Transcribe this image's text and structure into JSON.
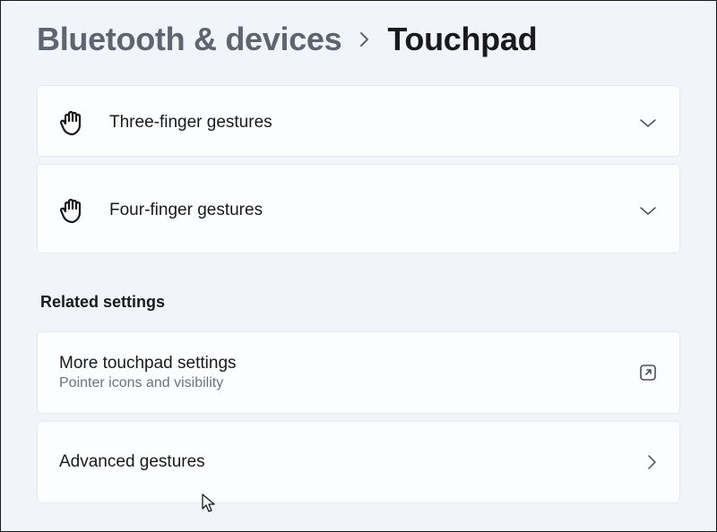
{
  "breadcrumb": {
    "parent": "Bluetooth & devices",
    "current": "Touchpad"
  },
  "gestures": {
    "three_label": "Three-finger gestures",
    "four_label": "Four-finger gestures"
  },
  "related": {
    "section_title": "Related settings",
    "more": {
      "title": "More touchpad settings",
      "subtitle": "Pointer icons and visibility"
    },
    "advanced": {
      "title": "Advanced gestures"
    }
  }
}
